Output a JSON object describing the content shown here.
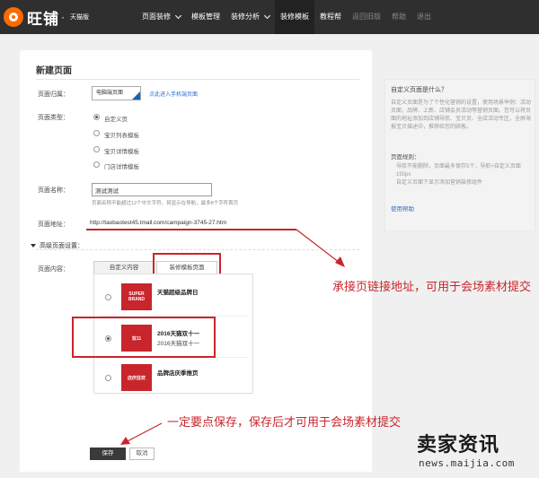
{
  "brand": {
    "name": "旺铺",
    "dot": "·",
    "sub": "天猫版"
  },
  "nav": [
    {
      "label": "页面装修",
      "dropdown": true,
      "dim": false
    },
    {
      "label": "模板管理",
      "dropdown": false,
      "dim": false
    },
    {
      "label": "装修分析",
      "dropdown": true,
      "dim": false
    },
    {
      "label": "装修模板",
      "dropdown": false,
      "dim": false
    },
    {
      "label": "教程帮",
      "dropdown": false,
      "dim": false
    },
    {
      "label": "返回旧版",
      "dropdown": false,
      "dim": true
    },
    {
      "label": "帮助",
      "dropdown": false,
      "dim": true
    },
    {
      "label": "退出",
      "dropdown": false,
      "dim": true
    }
  ],
  "form": {
    "title": "新建页面",
    "owner_label": "页面归属：",
    "owner_value": "电脑端页面",
    "owner_link": "点此进入手机端页面",
    "type_label": "页面类型：",
    "types": [
      {
        "label": "自定义页",
        "checked": true
      },
      {
        "label": "宝贝列表模板",
        "checked": false
      },
      {
        "label": "宝贝详情模板",
        "checked": false
      },
      {
        "label": "门店详情模板",
        "checked": false
      }
    ],
    "name_label": "页面名称：",
    "name_value": "测试测试",
    "name_hint": "页面名称不能超过12个中文字符，将显示在导航，最多8个字符首页",
    "url_label": "页面地址：",
    "url_value": "http://taobaotest45.tmall.com/campaign-3745-27.htm",
    "advanced_label": "高级页面设置：",
    "content_label": "页面内容：",
    "tabs": [
      {
        "label": "自定义内容",
        "active": false
      },
      {
        "label": "装修模板页面",
        "active": true
      }
    ],
    "templates": [
      {
        "title": "天猫超级品牌日",
        "sub": "",
        "thumb": "SUPER BRAND",
        "checked": false
      },
      {
        "title": "2016天猫双十一",
        "sub": "2016天猫双十一",
        "thumb": "双11",
        "checked": true
      },
      {
        "title": "品牌店庆季推页",
        "sub": "",
        "thumb": "店庆狂欢",
        "checked": false
      }
    ],
    "save_label": "保存",
    "cancel_label": "取消"
  },
  "help": {
    "title": "自定义页面是什么？",
    "body": "自定义页面是为了个性化营销的设置，使用场景举例：活动页面，品牌、上新、店铺会员活动等营销页面。您可以将页面的地址添加到店铺导航、宝贝页、全店活动专区，全屏海报宝贝描述中，推荐给您的顾客。",
    "sub_title": "页面规则：",
    "bullets": [
      "导航不能删除，页面最多保存5个，导航+自定义页面150px",
      "自定义页面下显示添加营销装修组件"
    ],
    "link": "使用帮助"
  },
  "annotations": {
    "url_note": "承接页链接地址，可用于会场素材提交",
    "save_note": "一定要点保存，保存后才可用于会场素材提交"
  },
  "watermark": {
    "main": "卖家资讯",
    "sub": "news.maijia.com"
  },
  "colors": {
    "topbar": "#2f2f2f",
    "accent_red": "#c9252c",
    "link_blue": "#2a6fc9",
    "brand_orange": "#ff6a00"
  }
}
